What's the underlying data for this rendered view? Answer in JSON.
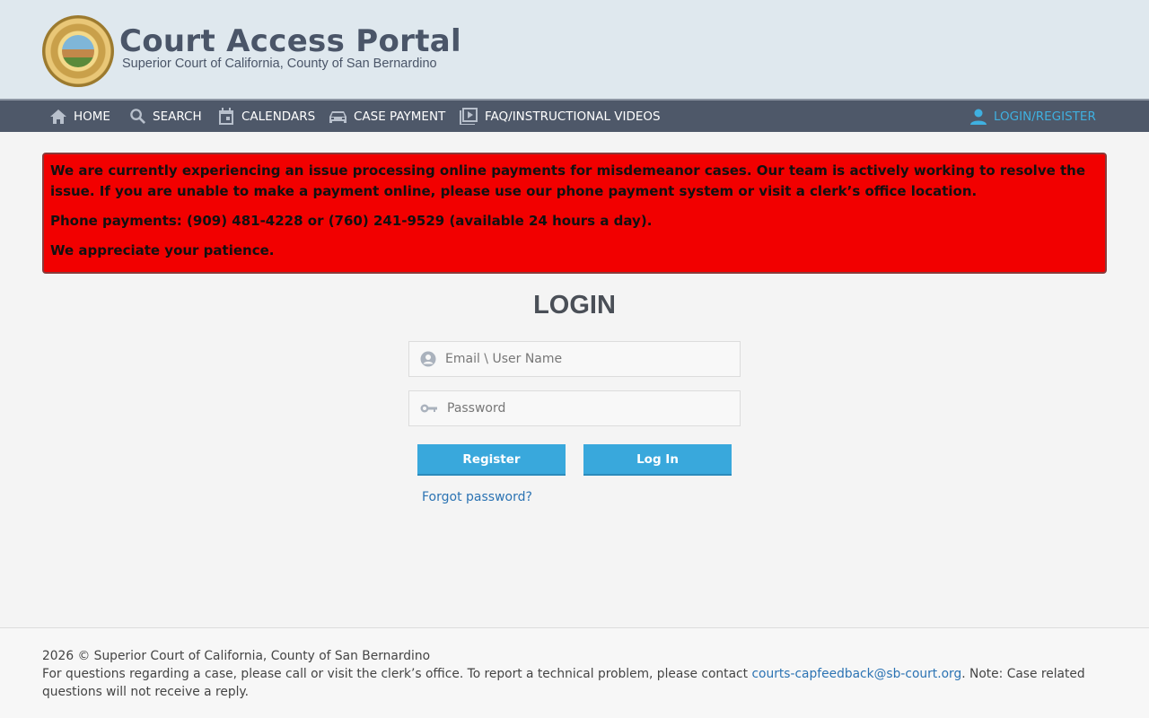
{
  "header": {
    "title": "Court Access Portal",
    "subtitle": "Superior Court of California, County of San Bernardino"
  },
  "nav": {
    "home": "HOME",
    "search": "SEARCH",
    "calendars": "CALENDARS",
    "case_payment": "CASE PAYMENT",
    "faq": "FAQ/INSTRUCTIONAL VIDEOS",
    "login": "LOGIN/REGISTER"
  },
  "alert": {
    "line1": "We are currently experiencing an issue processing online payments for misdemeanor cases. Our team is actively working to resolve the issue. If you are unable to make a payment online, please use our phone payment system or visit a clerk’s office location.",
    "line2": "Phone payments: (909) 481-4228 or (760) 241-9529 (available 24 hours a day).",
    "line3": "We appreciate your patience.",
    "background_color": "#f20000"
  },
  "login": {
    "title": "LOGIN",
    "username_placeholder": "Email \\ User Name",
    "password_placeholder": "Password",
    "register_label": "Register",
    "login_label": "Log In",
    "forgot_label": "Forgot password?"
  },
  "footer": {
    "copyright": "2026 © Superior Court of California, County of San Bernardino",
    "contact_prefix": "For questions regarding a case, please call or visit the clerk’s office. To report a technical problem, please contact ",
    "contact_email": "courts-capfeedback@sb-court.org",
    "contact_suffix": ". Note: Case related questions will not receive a reply."
  },
  "colors": {
    "nav_bg": "#4e5869",
    "accent": "#39a8dc",
    "header_bg": "#dfe8ee"
  }
}
